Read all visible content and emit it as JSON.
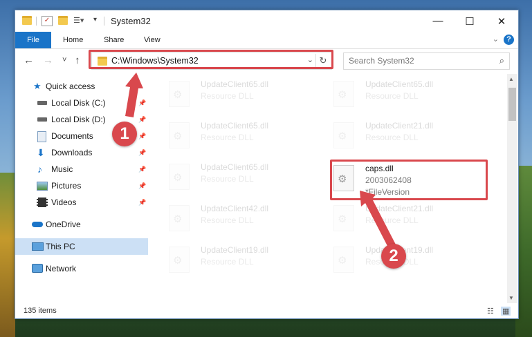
{
  "window": {
    "title": "System32",
    "minimize": "—",
    "maximize": "☐",
    "close": "✕"
  },
  "ribbon": {
    "tabs": [
      "File",
      "Home",
      "Share",
      "View"
    ],
    "collapse_icon": "chevron-down-icon"
  },
  "nav": {
    "back": "←",
    "forward": "→",
    "recent": "˅",
    "up": "↑",
    "address": "C:\\Windows\\System32",
    "search_placeholder": "Search System32",
    "refresh": "↻"
  },
  "sidebar": {
    "items": [
      {
        "label": "Quick access",
        "icon": "star-icon",
        "pinned": false
      },
      {
        "label": "Local Disk (C:)",
        "icon": "drive-icon",
        "pinned": true
      },
      {
        "label": "Local Disk (D:)",
        "icon": "drive-icon",
        "pinned": true
      },
      {
        "label": "Documents",
        "icon": "documents-icon",
        "pinned": true
      },
      {
        "label": "Downloads",
        "icon": "downloads-icon",
        "pinned": true
      },
      {
        "label": "Music",
        "icon": "music-icon",
        "pinned": true
      },
      {
        "label": "Pictures",
        "icon": "pictures-icon",
        "pinned": true
      },
      {
        "label": "Videos",
        "icon": "videos-icon",
        "pinned": true
      },
      {
        "label": "OneDrive",
        "icon": "cloud-icon",
        "pinned": false
      },
      {
        "label": "This PC",
        "icon": "computer-icon",
        "pinned": false,
        "selected": true
      },
      {
        "label": "Network",
        "icon": "network-icon",
        "pinned": false
      }
    ]
  },
  "files": {
    "left_column": [
      {
        "name": "UpdateClient65.dll",
        "type": "Resource DLL"
      },
      {
        "name": "UpdateClient65.dll",
        "type": "Resource DLL"
      },
      {
        "name": "UpdateClient65.dll",
        "type": "Resource DLL"
      },
      {
        "name": "UpdateClient42.dll",
        "type": "Resource DLL"
      },
      {
        "name": "UpdateClient19.dll",
        "type": "Resource DLL"
      }
    ],
    "right_column": [
      {
        "name": "UpdateClient65.dll",
        "type": "Resource DLL"
      },
      {
        "name": "UpdateClient21.dll",
        "type": "Resource DLL"
      },
      {
        "name": "UpdateClient21.dll",
        "type": "Resource DLL"
      },
      {
        "name": "UpdateClient19.dll",
        "type": "Resource DLL"
      }
    ],
    "highlighted": {
      "name": "caps.dll",
      "version": "2003062408",
      "description": "*FileVersion"
    }
  },
  "status": {
    "item_count": "135 items"
  },
  "annotations": {
    "marker1": "1",
    "marker2": "2",
    "color": "#d9484d"
  }
}
